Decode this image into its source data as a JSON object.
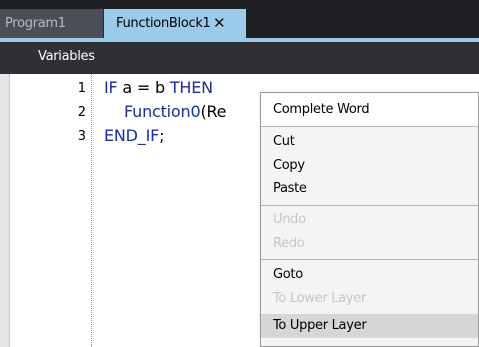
{
  "tabs": [
    {
      "label": "Program1",
      "active": false
    },
    {
      "label": "FunctionBlock1",
      "active": true,
      "close_glyph": "✕"
    }
  ],
  "variables_bar": {
    "label": "Variables"
  },
  "editor": {
    "line_numbers": [
      "1",
      "2",
      "3"
    ],
    "lines": [
      {
        "kw_if": "IF",
        "cond": " a = b ",
        "kw_then": "THEN"
      },
      {
        "fn": "Function0",
        "rest": "(Re"
      },
      {
        "kw_end": "END_IF",
        "rest": ";"
      }
    ]
  },
  "context_menu": {
    "items": [
      {
        "label": "Complete Word",
        "enabled": true
      },
      {
        "label": "Cut",
        "enabled": true
      },
      {
        "label": "Copy",
        "enabled": true
      },
      {
        "label": "Paste",
        "enabled": true
      },
      {
        "label": "Undo",
        "enabled": false
      },
      {
        "label": "Redo",
        "enabled": false
      },
      {
        "label": "Goto",
        "enabled": true
      },
      {
        "label": "To Lower Layer",
        "enabled": false
      },
      {
        "label": "To Upper Layer",
        "enabled": true,
        "highlighted": true
      }
    ]
  },
  "colors": {
    "tab_active_bg": "#9bcbea",
    "tab_inactive_bg": "#4b4e55",
    "keyword": "#1a2ea0",
    "menu_disabled_text": "#c6c6c6",
    "menu_highlight": "#d6d6d6"
  }
}
